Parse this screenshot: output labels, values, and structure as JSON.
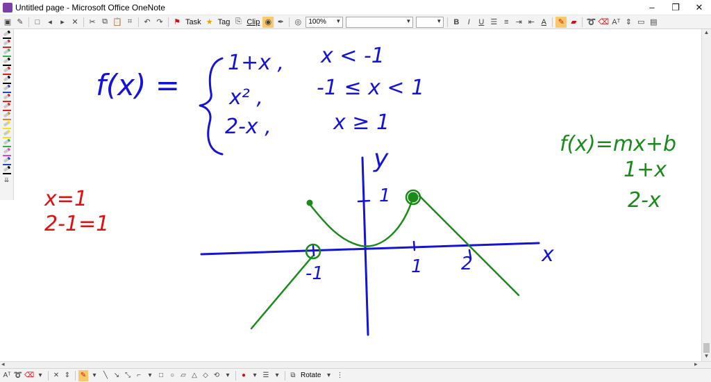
{
  "window": {
    "title": "Untitled page - Microsoft Office OneNote",
    "minimize": "–",
    "restore": "❐",
    "close": "✕"
  },
  "toolbar": {
    "task_label": "Task",
    "tag_label": "Tag",
    "clip_label": "Clip",
    "zoom_value": "100%",
    "bold": "B",
    "italic": "I",
    "underline": "U",
    "font_size_symbol": "A"
  },
  "bottom_toolbar": {
    "rotate_label": "Rotate"
  },
  "pen_palette": {
    "colors": [
      "#000000",
      "#e0201c",
      "#2bb24c",
      "#000000",
      "#e0201c",
      "#000000",
      "#2244cc",
      "#e0201c",
      "#e0201c",
      "#f07a1c",
      "#f5e11a",
      "#f5e11a",
      "#2bb24c",
      "#e040e0",
      "#2244cc",
      "#000000"
    ]
  },
  "notes": {
    "function_def": {
      "fx": "f(x) =",
      "piece1": "1+x ,",
      "cond1": "x < -1",
      "piece2": "x² ,",
      "cond2": "-1 ≤ x < 1",
      "piece3": "2-x ,",
      "cond3": "x ≥ 1"
    },
    "red_note": {
      "line1": "x=1",
      "line2": "2-1=1"
    },
    "green_note": {
      "line1": "f(x)=mx+b",
      "line2": "1+x",
      "line3": "2-x"
    },
    "axis_labels": {
      "y": "y",
      "x": "x",
      "y_tick": "1",
      "x_tick_neg1": "-1",
      "x_tick_1": "1",
      "x_tick_2": "2"
    }
  },
  "ink_colors": {
    "blue": "#1414d4",
    "red": "#e01010",
    "green": "#1a8a1a"
  }
}
